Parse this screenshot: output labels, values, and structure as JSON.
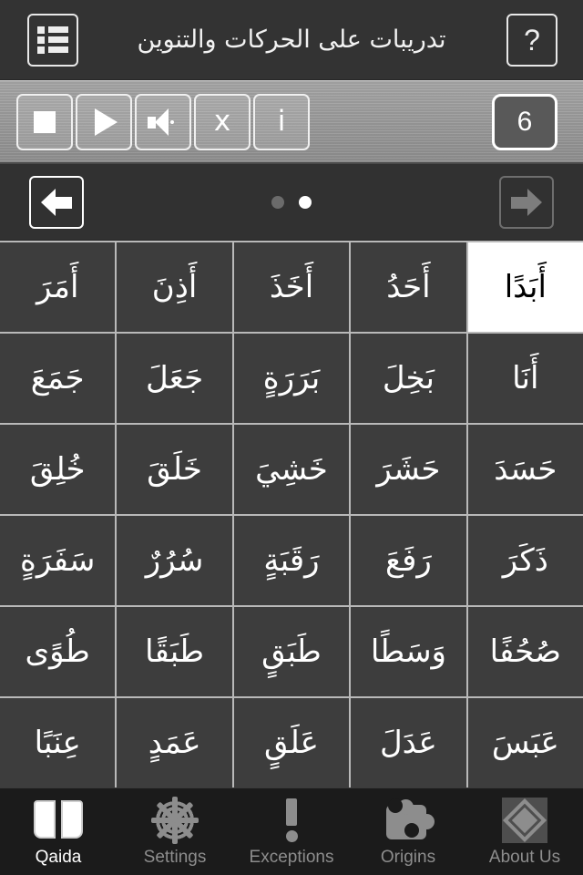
{
  "header": {
    "title": "تدريبات على الحركات والتنوين",
    "menu_icon": "list-icon",
    "help_label": "?"
  },
  "toolbar": {
    "stop_label": "stop-icon",
    "play_label": "play-icon",
    "sound_label": "speaker-icon",
    "close_label": "x",
    "info_label": "i",
    "counter": "6"
  },
  "pagination": {
    "prev_label": "back-arrow-icon",
    "next_label": "forward-arrow-icon",
    "dots": [
      {
        "active": false
      },
      {
        "active": true
      }
    ],
    "current_page": 2,
    "total_pages": 2
  },
  "grid": {
    "rows": [
      [
        {
          "text": "أَبَدًا",
          "selected": true
        },
        {
          "text": "أَحَدُ",
          "selected": false
        },
        {
          "text": "أَخَذَ",
          "selected": false
        },
        {
          "text": "أَذِنَ",
          "selected": false
        },
        {
          "text": "أَمَرَ",
          "selected": false
        }
      ],
      [
        {
          "text": "أَنَا",
          "selected": false
        },
        {
          "text": "بَخِلَ",
          "selected": false
        },
        {
          "text": "بَرَرَةٍ",
          "selected": false
        },
        {
          "text": "جَعَلَ",
          "selected": false
        },
        {
          "text": "جَمَعَ",
          "selected": false
        }
      ],
      [
        {
          "text": "حَسَدَ",
          "selected": false
        },
        {
          "text": "حَشَرَ",
          "selected": false
        },
        {
          "text": "خَشِيَ",
          "selected": false
        },
        {
          "text": "خَلَقَ",
          "selected": false
        },
        {
          "text": "خُلِقَ",
          "selected": false
        }
      ],
      [
        {
          "text": "ذَكَرَ",
          "selected": false
        },
        {
          "text": "رَفَعَ",
          "selected": false
        },
        {
          "text": "رَقَبَةٍ",
          "selected": false
        },
        {
          "text": "سُرُرٌ",
          "selected": false
        },
        {
          "text": "سَفَرَةٍ",
          "selected": false
        }
      ],
      [
        {
          "text": "صُحُفًا",
          "selected": false
        },
        {
          "text": "وَسَطًا",
          "selected": false
        },
        {
          "text": "طَبَقٍ",
          "selected": false
        },
        {
          "text": "طَبَقًا",
          "selected": false
        },
        {
          "text": "طُوًى",
          "selected": false
        }
      ],
      [
        {
          "text": "عَبَسَ",
          "selected": false
        },
        {
          "text": "عَدَلَ",
          "selected": false
        },
        {
          "text": "عَلَقٍ",
          "selected": false
        },
        {
          "text": "عَمَدٍ",
          "selected": false
        },
        {
          "text": "عِنَبًا",
          "selected": false
        }
      ]
    ]
  },
  "tabbar": {
    "items": [
      {
        "label": "Qaida",
        "icon": "book-icon",
        "active": true
      },
      {
        "label": "Settings",
        "icon": "gear-icon",
        "active": false
      },
      {
        "label": "Exceptions",
        "icon": "exclamation-icon",
        "active": false
      },
      {
        "label": "Origins",
        "icon": "puzzle-icon",
        "active": false
      },
      {
        "label": "About Us",
        "icon": "diamond-icon",
        "active": false
      }
    ]
  },
  "colors": {
    "header_bg": "#333333",
    "toolbar_bg": "#9c9c9c",
    "page_bg": "#2e2e2e",
    "cell_bg": "#3d3d3d",
    "cell_selected_bg": "#ffffff",
    "grid_line": "#b9b9b9",
    "tabbar_bg": "#1b1b1b",
    "active_text": "#ffffff",
    "inactive_text": "#8d8d8d"
  }
}
